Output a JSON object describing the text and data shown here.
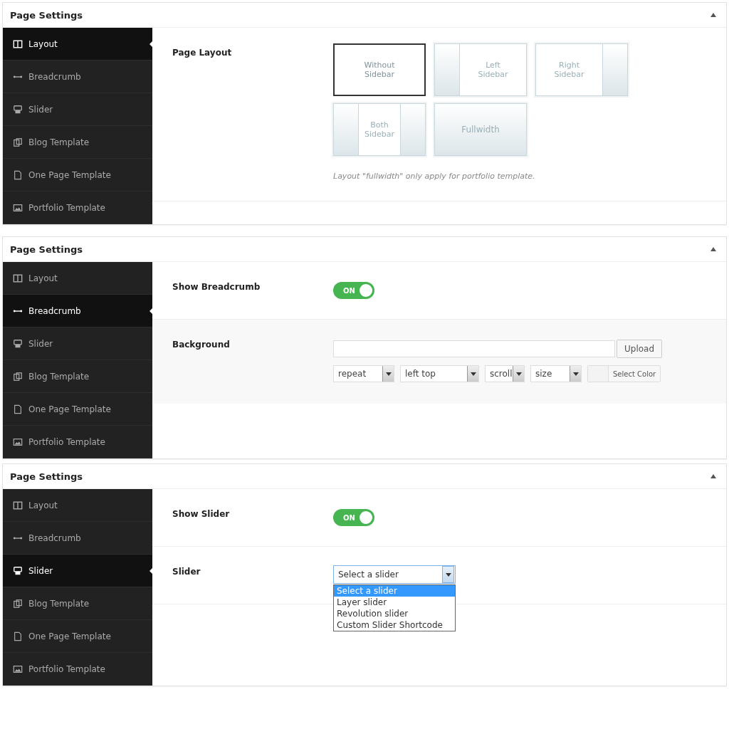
{
  "panels": [
    {
      "title": "Page Settings",
      "nav": [
        {
          "label": "Layout",
          "selected": true
        },
        {
          "label": "Breadcrumb",
          "selected": false
        },
        {
          "label": "Slider",
          "selected": false
        },
        {
          "label": "Blog Template",
          "selected": false
        },
        {
          "label": "One Page Template",
          "selected": false
        },
        {
          "label": "Portfolio Template",
          "selected": false
        }
      ],
      "fields": [
        {
          "kind": "layout",
          "label": "Page Layout",
          "note": "Layout \"fullwidth\" only apply for portfolio template.",
          "options": [
            {
              "kind": "none",
              "label": "Without Sidebar",
              "selected": true
            },
            {
              "kind": "left",
              "label": "Left Sidebar",
              "selected": false
            },
            {
              "kind": "right",
              "label": "Right Sidebar",
              "selected": false
            },
            {
              "kind": "both",
              "label": "Both Sidebar",
              "selected": false
            },
            {
              "kind": "full",
              "label": "Fullwidth",
              "selected": false
            }
          ]
        }
      ]
    },
    {
      "title": "Page Settings",
      "nav": [
        {
          "label": "Layout",
          "selected": false
        },
        {
          "label": "Breadcrumb",
          "selected": true
        },
        {
          "label": "Slider",
          "selected": false
        },
        {
          "label": "Blog Template",
          "selected": false
        },
        {
          "label": "One Page Template",
          "selected": false
        },
        {
          "label": "Portfolio Template",
          "selected": false
        }
      ],
      "fields": [
        {
          "kind": "toggle",
          "label": "Show Breadcrumb",
          "on": true,
          "text": "ON"
        },
        {
          "kind": "background",
          "label": "Background",
          "upload": "Upload",
          "selects": [
            "repeat",
            "left top",
            "scroll",
            "size"
          ],
          "color_button": "Select Color"
        }
      ]
    },
    {
      "title": "Page Settings",
      "nav": [
        {
          "label": "Layout",
          "selected": false
        },
        {
          "label": "Breadcrumb",
          "selected": false
        },
        {
          "label": "Slider",
          "selected": true
        },
        {
          "label": "Blog Template",
          "selected": false
        },
        {
          "label": "One Page Template",
          "selected": false
        },
        {
          "label": "Portfolio Template",
          "selected": false
        }
      ],
      "fields": [
        {
          "kind": "toggle",
          "label": "Show Slider",
          "on": true,
          "text": "ON"
        },
        {
          "kind": "select",
          "label": "Slider",
          "value": "Select a slider",
          "expanded": true,
          "options": [
            {
              "label": "Select a slider",
              "selected": true
            },
            {
              "label": "Layer slider",
              "selected": false
            },
            {
              "label": "Revolution slider",
              "selected": false
            },
            {
              "label": "Custom Slider Shortcode",
              "selected": false
            }
          ]
        }
      ]
    }
  ]
}
